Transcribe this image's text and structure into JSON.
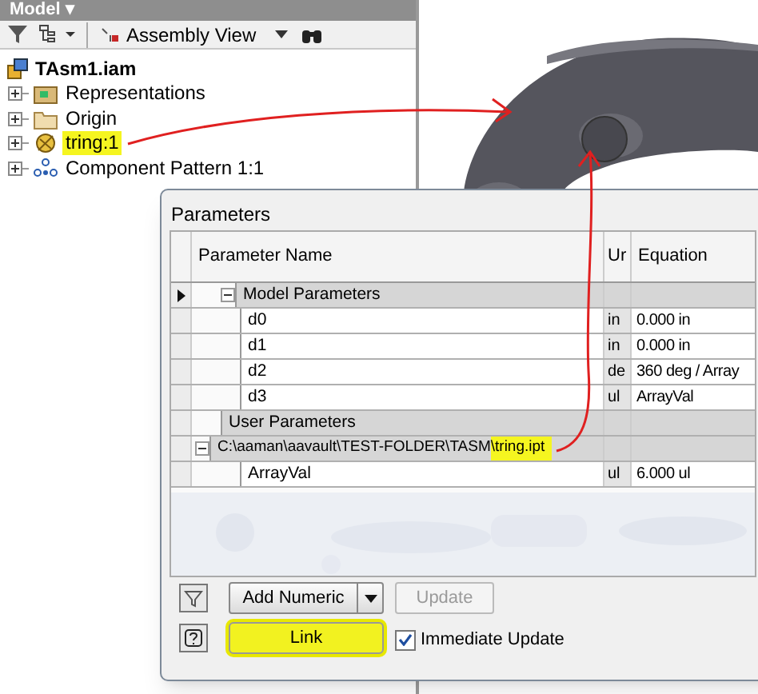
{
  "browser": {
    "title": "Model ▾",
    "toolbar": {
      "view_label": "Assembly View"
    },
    "tree": {
      "label": "TAsm1.iam",
      "children": [
        {
          "label": "Representations",
          "kind": "representations",
          "highlighted": false
        },
        {
          "label": "Origin",
          "kind": "folder",
          "highlighted": false
        },
        {
          "label": "tring:1",
          "kind": "part",
          "highlighted": true
        },
        {
          "label": "Component Pattern 1:1",
          "kind": "pattern",
          "highlighted": false
        }
      ]
    }
  },
  "dialog": {
    "title": "Parameters",
    "table": {
      "columns": [
        "Parameter Name",
        "Ur",
        "Equation"
      ],
      "rows": [
        {
          "kind": "group",
          "name": "Model Parameters",
          "expanded": true,
          "current": true
        },
        {
          "kind": "param",
          "name": "d0",
          "unit": "in",
          "equation": "0.000 in",
          "current": false
        },
        {
          "kind": "param",
          "name": "d1",
          "unit": "in",
          "equation": "0.000 in",
          "current": false
        },
        {
          "kind": "param",
          "name": "d2",
          "unit": "de",
          "equation": "360 deg / Array",
          "current": false
        },
        {
          "kind": "param",
          "name": "d3",
          "unit": "ul",
          "equation": "ArrayVal",
          "current": false
        },
        {
          "kind": "group",
          "name": "User Parameters",
          "current": false
        },
        {
          "kind": "file",
          "name": "C:\\aaman\\aavault\\TEST-FOLDER\\TASM",
          "highlight": "\\tring.ipt",
          "expanded": true,
          "current": false
        },
        {
          "kind": "param",
          "name": "ArrayVal",
          "unit": "ul",
          "equation": "6.000 ul",
          "current": false
        }
      ]
    },
    "buttons": {
      "add": "Add Numeric",
      "update": "Update",
      "update_disabled": true,
      "link": "Link",
      "link_highlighted": true
    },
    "immediate_update": {
      "label": "Immediate Update",
      "checked": true
    }
  }
}
